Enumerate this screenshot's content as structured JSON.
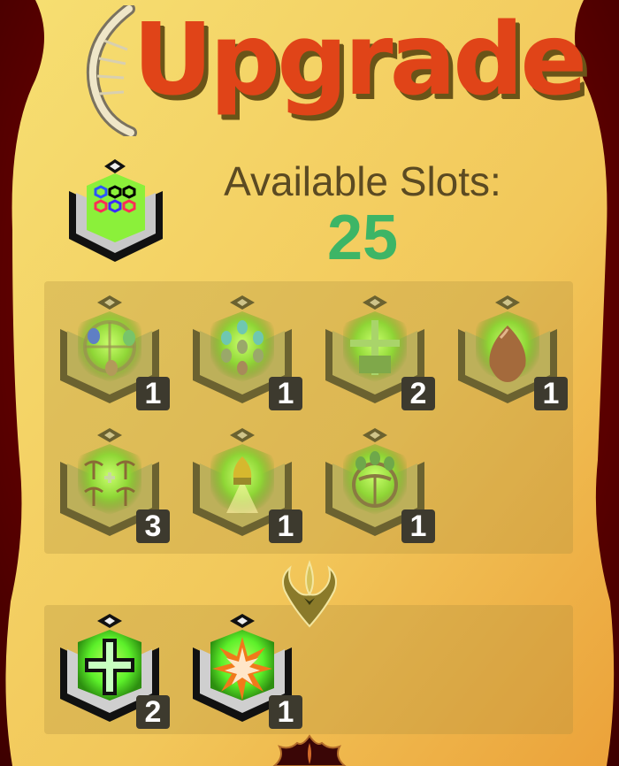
{
  "title": "Upgrade",
  "slots": {
    "label": "Available Slots:",
    "value": "25"
  },
  "colors": {
    "title": "#e04418",
    "slots_value": "#3db566",
    "count_badge": "#3d3a2e",
    "glow": "#7cff2a"
  },
  "upgrades": [
    {
      "icon": "droplet-wheel-icon",
      "count": "1"
    },
    {
      "icon": "multi-droplet-icon",
      "count": "1"
    },
    {
      "icon": "crossed-bones-icon",
      "count": "2"
    },
    {
      "icon": "egg-icon",
      "count": "1"
    },
    {
      "icon": "crossbow-cluster-icon",
      "count": "3"
    },
    {
      "icon": "rocket-droplet-icon",
      "count": "1"
    },
    {
      "icon": "wheel-droplets-icon",
      "count": "1"
    }
  ],
  "active": [
    {
      "icon": "green-cross-icon",
      "count": "2"
    },
    {
      "icon": "starburst-icon",
      "count": "1"
    }
  ]
}
